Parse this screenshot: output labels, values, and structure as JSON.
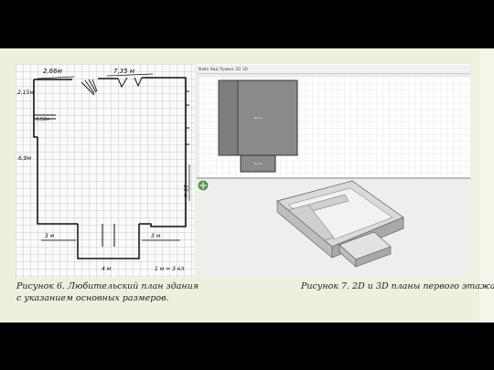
{
  "captions": {
    "fig6_line1": "Рисунок 6. Любительский план здания",
    "fig6_line2": "с указанием основных размеров.",
    "fig7": "Рисунок 7. 2D и 3D планы первого этажа"
  },
  "sketch_labels": {
    "top_left": "2,66м",
    "top_right": "7,35 м",
    "left_upper": "2,15м",
    "left_small": "0,52м",
    "left_mid": "6,9м",
    "right_side": "18 м",
    "bottom_left": "3 м",
    "bottom_right": "3 м",
    "bottom_center": "4 м",
    "scale": "1 м = 3 кл"
  },
  "editor": {
    "tabs": [
      "Файл",
      "Вид",
      "Правка",
      "2D",
      "3D"
    ],
    "room_label_upper": "Room",
    "room_label_lower": "Room"
  },
  "colors": {
    "slide_bg": "#ebf1de",
    "frame": "#000000",
    "room_fill": "#8a8a8a",
    "grid_line": "#c9d2e0"
  }
}
